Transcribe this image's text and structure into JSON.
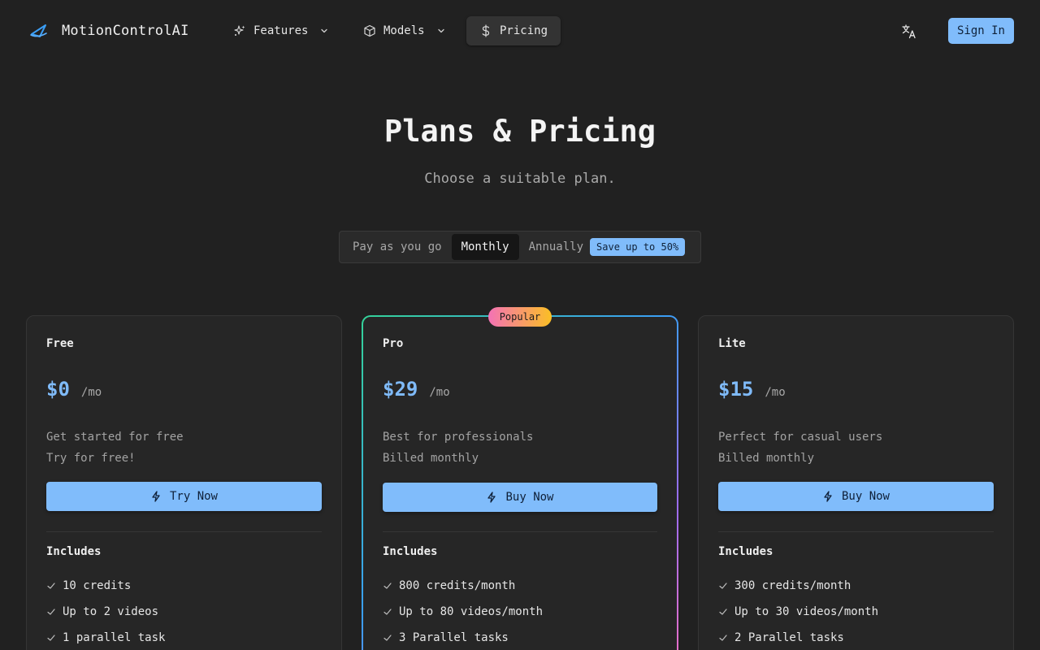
{
  "brand": {
    "name": "MotionControlAI",
    "logo_icon": "paper-plane-logo-icon",
    "accent": "#3b9ef5"
  },
  "nav": {
    "features": {
      "label": "Features",
      "icon": "sparkles-icon"
    },
    "models": {
      "label": "Models",
      "icon": "cube-icon"
    },
    "pricing": {
      "label": "Pricing",
      "icon": "dollar-icon"
    },
    "language_icon": "translate-icon",
    "sign_in": "Sign In"
  },
  "hero": {
    "title": "Plans & Pricing",
    "subtitle": "Choose a suitable plan."
  },
  "billing": {
    "options": [
      "Pay as you go",
      "Monthly",
      "Annually"
    ],
    "selected": "Monthly",
    "save_badge": "Save up to 50%"
  },
  "plans": [
    {
      "name": "Free",
      "price": "$0",
      "period": "/mo",
      "desc_line1": "Get started for free",
      "desc_line2": "Try for free!",
      "cta": "Try Now",
      "includes": "Includes",
      "features": [
        "10 credits",
        "Up to 2 videos",
        "1 parallel task"
      ]
    },
    {
      "name": "Pro",
      "badge": "Popular",
      "price": "$29",
      "period": "/mo",
      "desc_line1": "Best for professionals",
      "desc_line2": "Billed monthly",
      "cta": "Buy Now",
      "includes": "Includes",
      "features": [
        "800 credits/month",
        "Up to 80 videos/month",
        "3 Parallel tasks"
      ]
    },
    {
      "name": "Lite",
      "price": "$15",
      "period": "/mo",
      "desc_line1": "Perfect for casual users",
      "desc_line2": "Billed monthly",
      "cta": "Buy Now",
      "includes": "Includes",
      "features": [
        "300 credits/month",
        "Up to 30 videos/month",
        "2 Parallel tasks"
      ]
    }
  ],
  "colors": {
    "background": "#212121",
    "card": "#262626",
    "primary_button": "#80bcfb",
    "price": "#7fbaf8"
  }
}
